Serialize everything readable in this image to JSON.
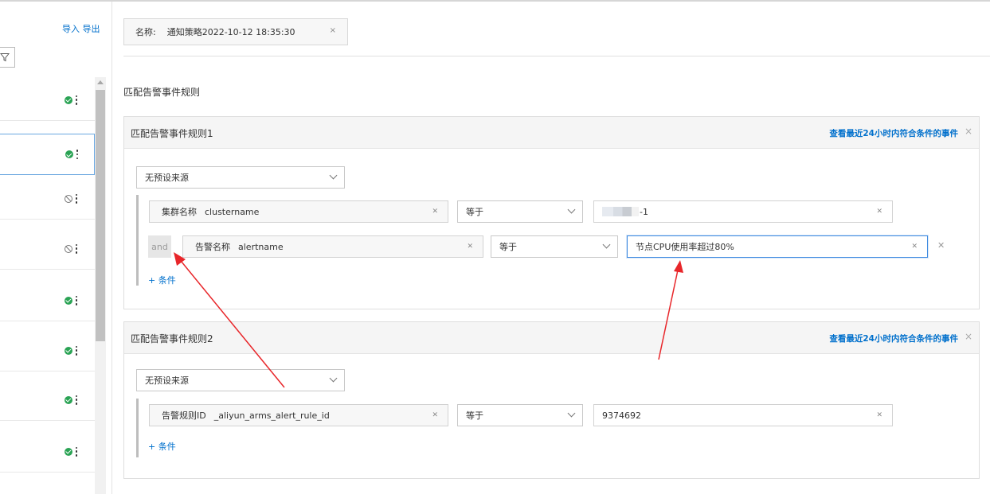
{
  "left_panel": {
    "import_label": "导入",
    "export_label": "导出",
    "items": [
      {
        "status": "enabled"
      },
      {
        "status": "enabled",
        "selected": true
      },
      {
        "status": "disabled"
      },
      {
        "status": "disabled"
      },
      {
        "status": "enabled"
      },
      {
        "status": "enabled"
      },
      {
        "status": "enabled"
      },
      {
        "status": "enabled"
      }
    ]
  },
  "name_tag": {
    "label": "名称:",
    "value": "通知策略2022-10-12 18:35:30",
    "close": "×"
  },
  "section_title": "匹配告警事件规则",
  "rules": [
    {
      "title": "匹配告警事件规则1",
      "link": "查看最近24小时内符合条件的事件",
      "close": "×",
      "source": "无预设来源",
      "conditions": [
        {
          "field_label": "集群名称",
          "field_key": "clustername",
          "operator": "等于",
          "value_suffix": "-1"
        },
        {
          "connector": "and",
          "field_label": "告警名称",
          "field_key": "alertname",
          "operator": "等于",
          "value": "节点CPU使用率超过80%"
        }
      ],
      "add_condition": "+ 条件"
    },
    {
      "title": "匹配告警事件规则2",
      "link": "查看最近24小时内符合条件的事件",
      "close": "×",
      "source": "无预设来源",
      "conditions": [
        {
          "field_label": "告警规则ID",
          "field_key": "_aliyun_arms_alert_rule_id",
          "operator": "等于",
          "value": "9374692"
        }
      ],
      "add_condition": "+ 条件"
    }
  ],
  "colors": {
    "link": "#0070cc",
    "ok": "#2aa354",
    "annotation_arrow": "#e8262a",
    "focus": "#3f8ae0"
  }
}
